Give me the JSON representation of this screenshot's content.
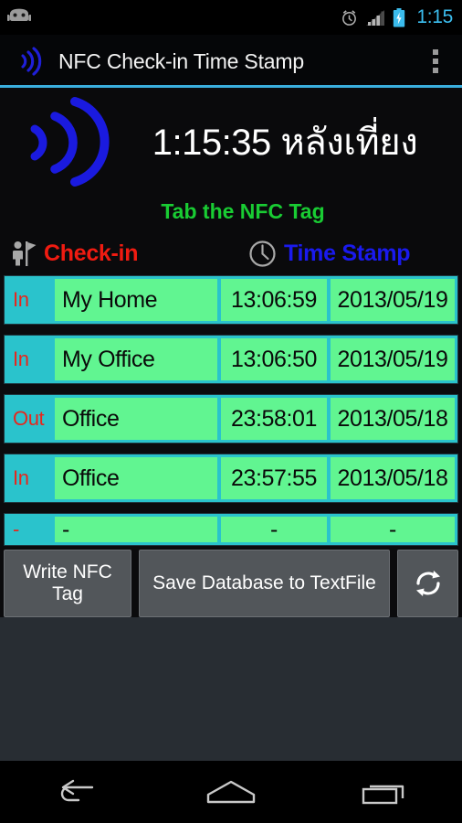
{
  "status_bar": {
    "mascot_icon": "android-mascot-icon",
    "alarm_icon": "alarm-clock-icon",
    "signal_icon": "signal-bars-icon",
    "battery_icon": "battery-charging-icon",
    "time": "1:15",
    "time_color": "#3bbced"
  },
  "action_bar": {
    "logo_icon": "nfc-wave-icon",
    "title": "NFC Check-in Time Stamp",
    "overflow_icon": "overflow-menu-icon"
  },
  "hero": {
    "nfc_icon": "nfc-wave-icon",
    "nfc_color": "#1a1adf",
    "clock": "1:15:35 หลังเที่ยง",
    "hint": "Tab the NFC Tag",
    "hint_color": "#19cc33"
  },
  "column_headers": {
    "checkin_icon": "person-flag-icon",
    "checkin_label": "Check-in",
    "checkin_color": "#f01b11",
    "timestamp_icon": "clock-outline-icon",
    "timestamp_label": "Time Stamp",
    "timestamp_color": "#1a1aee"
  },
  "table": {
    "row_bg": "#2ac3cc",
    "cell_bg": "#61f591",
    "rows": [
      {
        "direction": "In",
        "name": "My Home",
        "time": "13:06:59",
        "date": "2013/05/19"
      },
      {
        "direction": "In",
        "name": "My Office",
        "time": "13:06:50",
        "date": "2013/05/19"
      },
      {
        "direction": "Out",
        "name": "Office",
        "time": "23:58:01",
        "date": "2013/05/18"
      },
      {
        "direction": "In",
        "name": "Office",
        "time": "23:57:55",
        "date": "2013/05/18"
      },
      {
        "direction": "-",
        "name": "-",
        "time": "-",
        "date": "-"
      }
    ]
  },
  "buttons": {
    "write_nfc": "Write NFC Tag",
    "save_db": "Save Database to TextFile",
    "refresh_icon": "refresh-icon"
  },
  "nav_bar": {
    "back_icon": "back-icon",
    "home_icon": "home-icon",
    "recents_icon": "recent-apps-icon"
  }
}
